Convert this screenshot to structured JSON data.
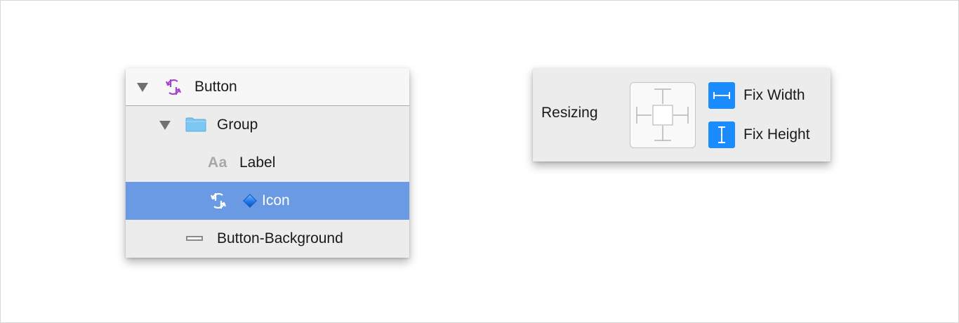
{
  "layers": {
    "rows": [
      {
        "label": "Button",
        "icon": "symbol-instance-icon",
        "expanded": true
      },
      {
        "label": "Group",
        "icon": "folder-icon",
        "expanded": true
      },
      {
        "label": "Label",
        "icon": "text-layer-icon",
        "icon_text": "Aa"
      },
      {
        "label": "Icon",
        "icon": "symbol-instance-icon",
        "selected": true
      },
      {
        "label": "Button-Background",
        "icon": "rectangle-layer-icon"
      }
    ]
  },
  "resizing": {
    "title": "Resizing",
    "options": [
      {
        "label": "Fix Width",
        "icon": "fix-width-icon",
        "checked": true
      },
      {
        "label": "Fix Height",
        "icon": "fix-height-icon",
        "checked": true
      }
    ]
  },
  "colors": {
    "selection": "#6a9ae3",
    "accent": "#1a8cff",
    "symbol_purple": "#a347c8",
    "folder_blue": "#7cc6f2"
  }
}
